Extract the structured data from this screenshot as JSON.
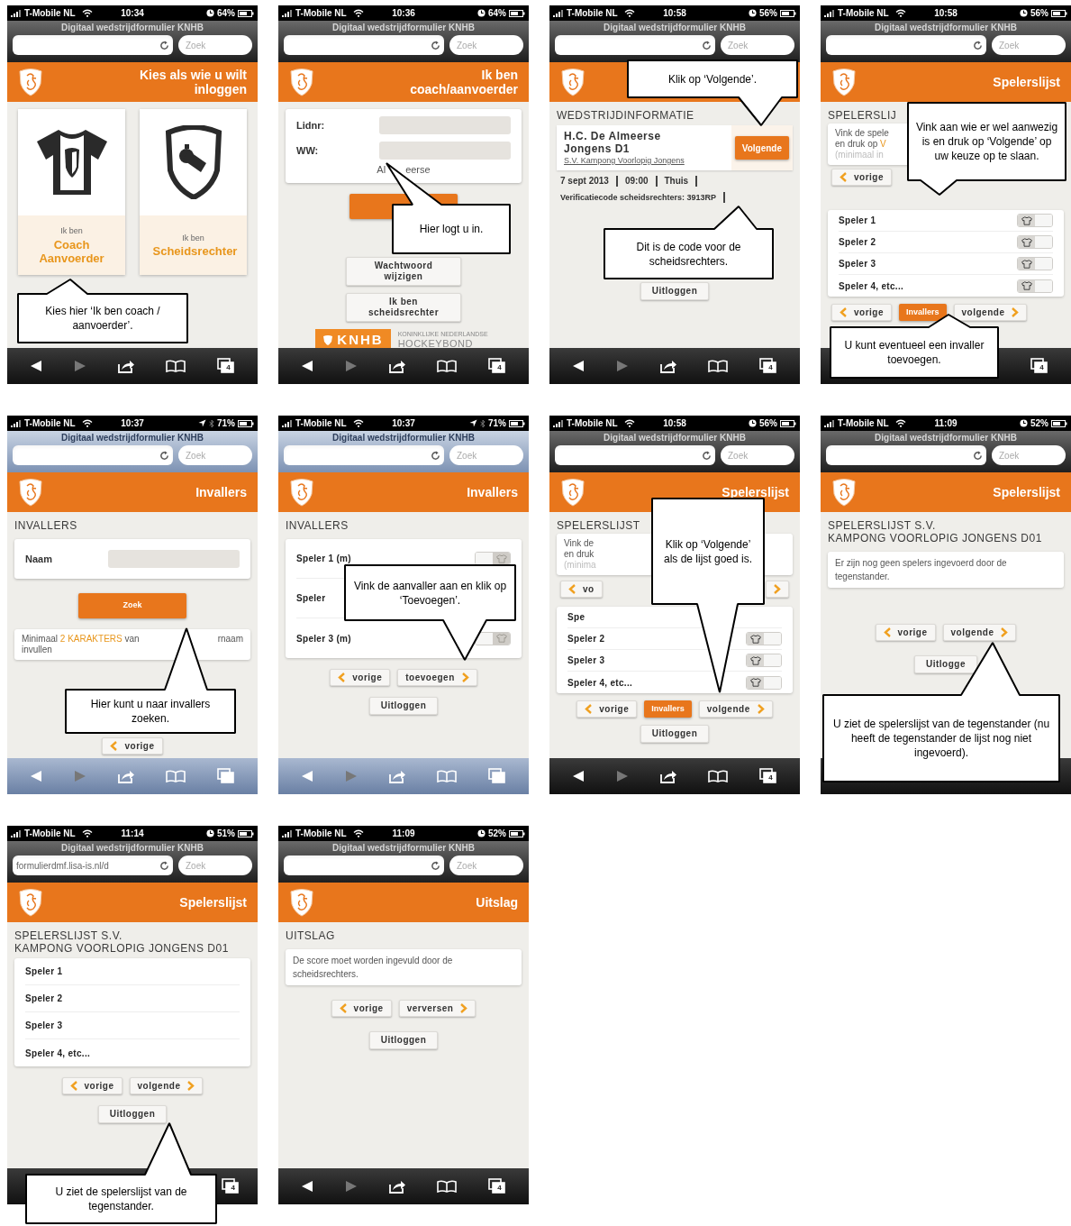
{
  "screens": [
    {
      "status": {
        "carrier": "T-Mobile NL",
        "time": "10:34",
        "battery": "64%"
      },
      "browser": {
        "title": "Digitaal wedstrijdformulier KNHB",
        "search_placeholder": "Zoek"
      },
      "header": {
        "title": "Kies als wie u wilt inloggen"
      },
      "content": [
        {
          "kind": "cards",
          "items": [
            {
              "caption": "Ik ben",
              "label": "Coach Aanvoerder"
            },
            {
              "caption": "Ik ben",
              "label": "Scheidsrechter"
            }
          ]
        }
      ],
      "toolbar": {
        "tab_count": "4"
      },
      "callouts": [
        {
          "text": "Kies hier ‘Ik ben coach / aanvoerder’."
        }
      ]
    },
    {
      "status": {
        "carrier": "T-Mobile NL",
        "time": "10:36",
        "battery": "64%"
      },
      "browser": {
        "title": "Digitaal wedstrijdformulier KNHB",
        "search_placeholder": "Zoek"
      },
      "header": {
        "title": "Ik ben coach/aanvoerder"
      },
      "content": [
        {
          "kind": "form",
          "fields": [
            {
              "label": "Lidnr:"
            },
            {
              "label": "WW:"
            }
          ],
          "fragments": [
            "Al",
            "eerse"
          ]
        },
        {
          "kind": "primary_button"
        },
        {
          "kind": "plain_button",
          "label": "Wachtwoord wijzigen"
        },
        {
          "kind": "plain_button",
          "label": "Ik ben scheidsrechter"
        },
        {
          "kind": "logo",
          "mark": "KNHB",
          "subtitle": "KONINKLIJKE NEDERLANDSE",
          "name": "HOCKEYBOND"
        }
      ],
      "toolbar": {
        "tab_count": "4"
      },
      "callouts": [
        {
          "text": "Hier logt u in."
        }
      ]
    },
    {
      "status": {
        "carrier": "T-Mobile NL",
        "time": "10:58",
        "battery": "56%"
      },
      "browser": {
        "title": "Digitaal wedstrijdformulier KNHB",
        "search_placeholder": "Zoek"
      },
      "content": [
        {
          "kind": "heading",
          "lines": [
            "WEDSTRIJDINFORMATIE"
          ]
        },
        {
          "kind": "match",
          "team": "H.C. De Almeerse",
          "squad": "Jongens D1",
          "opponent": "S.V. Kampong Voorlopig Jongens",
          "button": "Volgende",
          "meta": [
            "7 sept 2013",
            "09:00",
            "Thuis"
          ],
          "code": "Verificatiecode scheidsrechters: 3913RP"
        },
        {
          "kind": "plain_button",
          "label": "Uitloggen"
        }
      ],
      "toolbar": {
        "tab_count": "4"
      },
      "callouts": [
        {
          "text": "Klik op ‘Volgende’."
        },
        {
          "text": "Dit is de code voor de scheidsrechters."
        }
      ]
    },
    {
      "status": {
        "carrier": "T-Mobile NL",
        "time": "10:58",
        "battery": "56%"
      },
      "browser": {
        "title": "Digitaal wedstrijdformulier KNHB",
        "search_placeholder": "Zoek"
      },
      "header": {
        "title": "Spelerslijst"
      },
      "content": [
        {
          "kind": "heading",
          "lines": [
            "SPELERSLIJ"
          ]
        },
        {
          "kind": "note",
          "lines": [
            {
              "faded": false,
              "segments": [
                {
                  "text": "Vink de spele",
                  "accent": false
                }
              ]
            },
            {
              "faded": false,
              "segments": [
                {
                  "text": "en druk op ",
                  "accent": false
                },
                {
                  "text": "V",
                  "accent": true
                }
              ]
            },
            {
              "faded": true,
              "segments": [
                {
                  "text": "(minimaal in",
                  "accent": false
                }
              ]
            }
          ]
        },
        {
          "kind": "buttons",
          "items": [
            {
              "kind": "back",
              "label": "vorige"
            }
          ]
        },
        {
          "kind": "players",
          "rows": [
            {
              "name": "Speler 1",
              "checked": false
            },
            {
              "name": "Speler 2",
              "checked": false
            },
            {
              "name": "Speler 3",
              "checked": false
            },
            {
              "name": "Speler 4, etc...",
              "checked": false
            }
          ]
        },
        {
          "kind": "buttons",
          "items": [
            {
              "kind": "back",
              "label": "vorige"
            },
            {
              "kind": "primary",
              "label": "Invallers"
            },
            {
              "kind": "next",
              "label": "volgende"
            }
          ]
        }
      ],
      "toolbar": {
        "tab_count": "4"
      },
      "callouts": [
        {
          "text": "Vink aan wie er wel aanwezig is en druk op ‘Volgende’ op uw keuze op te slaan."
        },
        {
          "text": "U kunt eventueel een invaller toevoegen."
        }
      ]
    },
    {
      "status": {
        "carrier": "T-Mobile NL",
        "time": "10:37",
        "battery": "71%"
      },
      "browser": {
        "title": "Digitaal wedstrijdformulier KNHB",
        "search_placeholder": "Zoek"
      },
      "header": {
        "title": "Invallers"
      },
      "content": [
        {
          "kind": "heading",
          "lines": [
            "INVALLERS"
          ]
        },
        {
          "kind": "form",
          "fields": [
            {
              "label": "Naam"
            }
          ]
        },
        {
          "kind": "primary_button",
          "label": "Zoek"
        },
        {
          "kind": "note",
          "lines": [
            {
              "faded": false,
              "segments": [
                {
                  "text": "Minimaal ",
                  "accent": false
                },
                {
                  "text": "2 KARAKTERS",
                  "accent": true
                },
                {
                  "text": " van",
                  "accent": false
                }
              ],
              "end": "rnaam"
            },
            {
              "faded": false,
              "segments": [
                {
                  "text": "invullen",
                  "accent": false
                }
              ]
            }
          ]
        },
        {
          "kind": "buttons",
          "items": [
            {
              "kind": "back",
              "label": "vorige"
            }
          ]
        }
      ],
      "callouts": [
        {
          "text": "Hier kunt u naar invallers zoeken."
        }
      ]
    },
    {
      "status": {
        "carrier": "T-Mobile NL",
        "time": "10:37",
        "battery": "71%"
      },
      "browser": {
        "title": "Digitaal wedstrijdformulier KNHB",
        "search_placeholder": "Zoek"
      },
      "header": {
        "title": "Invallers"
      },
      "content": [
        {
          "kind": "heading",
          "lines": [
            "INVALLERS"
          ]
        },
        {
          "kind": "players",
          "rows": [
            {
              "name": "Speler 1 (m)",
              "checked": true
            },
            {
              "name": "Speler"
            },
            {
              "name": "Speler 3 (m)",
              "checked": true
            }
          ]
        },
        {
          "kind": "buttons",
          "items": [
            {
              "kind": "back",
              "label": "vorige"
            },
            {
              "kind": "next",
              "label": "toevoegen"
            }
          ]
        },
        {
          "kind": "plain_button",
          "label": "Uitloggen"
        }
      ],
      "callouts": [
        {
          "text": "Vink de aanvaller aan en klik op ‘Toevoegen’."
        }
      ]
    },
    {
      "status": {
        "carrier": "T-Mobile NL",
        "time": "10:58",
        "battery": "56%"
      },
      "browser": {
        "title": "Digitaal wedstrijdformulier KNHB",
        "search_placeholder": "Zoek"
      },
      "header": {
        "title": "Spelerslijst"
      },
      "content": [
        {
          "kind": "heading",
          "lines": [
            "SPELERSLIJST"
          ]
        },
        {
          "kind": "note",
          "lines": [
            {
              "faded": false,
              "segments": [
                {
                  "text": "Vink de",
                  "accent": false
                }
              ]
            },
            {
              "faded": false,
              "segments": [
                {
                  "text": "en druk",
                  "accent": false
                }
              ]
            },
            {
              "faded": true,
              "segments": [
                {
                  "text": "(minima",
                  "accent": false
                }
              ]
            }
          ]
        },
        {
          "kind": "buttons",
          "items": [
            {
              "kind": "back",
              "label": "vo"
            },
            {
              "kind": "next"
            }
          ]
        },
        {
          "kind": "players",
          "rows": [
            {
              "name": "Spe"
            },
            {
              "name": "Speler 2",
              "checked": false
            },
            {
              "name": "Speler 3",
              "checked": false
            },
            {
              "name": "Speler 4, etc...",
              "checked": false
            }
          ]
        },
        {
          "kind": "buttons",
          "items": [
            {
              "kind": "back",
              "label": "vorige"
            },
            {
              "kind": "primary",
              "label": "Invallers"
            },
            {
              "kind": "next",
              "label": "volgende"
            }
          ]
        },
        {
          "kind": "plain_button",
          "label": "Uitloggen"
        }
      ],
      "toolbar": {
        "tab_count": "4"
      },
      "callouts": [
        {
          "text": "Klik op ‘Volgende’ als de lijst goed is."
        }
      ]
    },
    {
      "status": {
        "carrier": "T-Mobile NL",
        "time": "11:09",
        "battery": "52%"
      },
      "browser": {
        "title": "Digitaal wedstrijdformulier KNHB",
        "search_placeholder": "Zoek"
      },
      "header": {
        "title": "Spelerslijst"
      },
      "content": [
        {
          "kind": "heading",
          "lines": [
            "SPELERSLIJST S.V.",
            "KAMPONG VOORLOPIG JONGENS D01"
          ]
        },
        {
          "kind": "note",
          "text": "Er zijn nog geen spelers ingevoerd door de tegenstander."
        },
        {
          "kind": "buttons",
          "items": [
            {
              "kind": "back",
              "label": "vorige"
            },
            {
              "kind": "next",
              "label": "volgende"
            }
          ]
        },
        {
          "kind": "plain_button",
          "label": "Uitlogge"
        }
      ],
      "callouts": [
        {
          "text": "U ziet de spelerslijst van de tegenstander (nu heeft de tegenstander de lijst nog niet ingevoerd)."
        }
      ]
    },
    {
      "status": {
        "carrier": "T-Mobile NL",
        "time": "11:14",
        "battery": "51%"
      },
      "browser": {
        "title": "Digitaal wedstrijdformulier KNHB",
        "url": "formulierdmf.lisa-is.nl/d",
        "search_placeholder": "Zoek"
      },
      "header": {
        "title": "Spelerslijst"
      },
      "content": [
        {
          "kind": "heading",
          "lines": [
            "SPELERSLIJST S.V.",
            "KAMPONG VOORLOPIG JONGENS D01"
          ]
        },
        {
          "kind": "players",
          "rows": [
            {
              "name": "Speler 1"
            },
            {
              "name": "Speler 2"
            },
            {
              "name": "Speler 3"
            },
            {
              "name": "Speler 4, etc..."
            }
          ]
        },
        {
          "kind": "buttons",
          "items": [
            {
              "kind": "back",
              "label": "vorige"
            },
            {
              "kind": "next",
              "label": "volgende"
            }
          ]
        },
        {
          "kind": "plain_button",
          "label": "Uitloggen"
        }
      ],
      "toolbar": {
        "tab_count": "4"
      },
      "callouts": [
        {
          "text": "U ziet de spelerslijst van de tegenstander."
        }
      ]
    },
    {
      "status": {
        "carrier": "T-Mobile NL",
        "time": "11:09",
        "battery": "52%"
      },
      "browser": {
        "title": "Digitaal wedstrijdformulier KNHB",
        "search_placeholder": "Zoek"
      },
      "header": {
        "title": "Uitslag"
      },
      "content": [
        {
          "kind": "heading",
          "lines": [
            "UITSLAG"
          ]
        },
        {
          "kind": "note",
          "text": "De score moet worden ingevuld door de scheidsrechters."
        },
        {
          "kind": "buttons",
          "items": [
            {
              "kind": "back",
              "label": "vorige"
            },
            {
              "kind": "next",
              "label": "verversen"
            }
          ]
        },
        {
          "kind": "plain_button",
          "label": "Uitloggen"
        }
      ],
      "toolbar": {
        "tab_count": "4"
      }
    }
  ]
}
